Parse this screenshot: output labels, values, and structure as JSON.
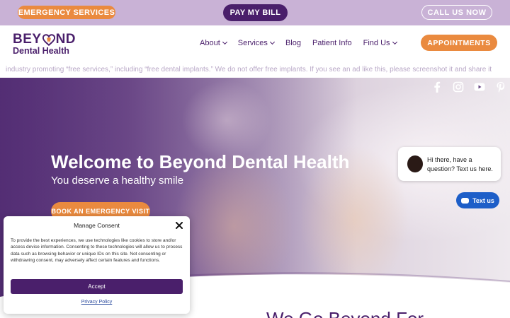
{
  "topbar": {
    "emergency_label": "EMERGENCY SERVICES",
    "paybill_label": "PAY MY BILL",
    "callus_label": "CALL US NOW"
  },
  "logo": {
    "line1a": "BEY",
    "line1b": "ND",
    "line2": "Dental Health"
  },
  "nav": {
    "items": [
      {
        "label": "About",
        "has_dropdown": true
      },
      {
        "label": "Services",
        "has_dropdown": true
      },
      {
        "label": "Blog",
        "has_dropdown": false
      },
      {
        "label": "Patient Info",
        "has_dropdown": false
      },
      {
        "label": "Find Us",
        "has_dropdown": true
      }
    ],
    "appointments_label": "APPOINTMENTS"
  },
  "ticker": {
    "text": "industry promoting “free services,” including “free dental implants.” We do not offer free implants. If you see an ad like this, please screenshot it and share it"
  },
  "social": [
    "facebook-icon",
    "instagram-icon",
    "youtube-icon",
    "pinterest-icon"
  ],
  "hero": {
    "title": "Welcome to Beyond Dental Health",
    "subtitle": "You deserve a healthy smile",
    "button_label": "BOOK AN EMERGENCY VISIT"
  },
  "section": {
    "heading_partial": "We Go Beyond For"
  },
  "chat": {
    "message": "Hi there, have a question? Text us here.",
    "button_label": "Text us"
  },
  "consent": {
    "title": "Manage Consent",
    "body": "To provide the best experiences, we use technologies like cookies to store and/or access device information. Consenting to these technologies will allow us to process data such as browsing behavior or unique IDs on this site. Not consenting or withdrawing consent, may adversely affect certain features and functions.",
    "accept_label": "Accept",
    "privacy_label": "Privacy Policy"
  },
  "colors": {
    "brand_purple": "#4a1f6b",
    "accent_orange": "#ea8a3f",
    "topbar_lavender": "#c9b2d6",
    "chat_blue": "#1d5ec8"
  }
}
